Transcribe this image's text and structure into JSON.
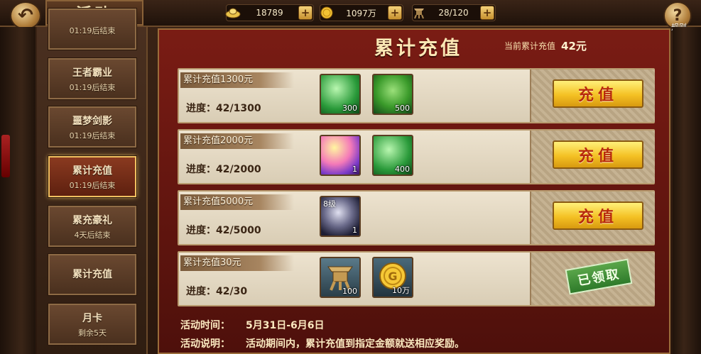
{
  "header": {
    "title": "活动",
    "back_icon": "back-arrow-icon",
    "help_label": "规则",
    "resources": [
      {
        "icon": "ingot-icon",
        "value": "18789"
      },
      {
        "icon": "gold-coin-icon",
        "value": "1097万"
      },
      {
        "icon": "vessel-icon",
        "value": "28/120"
      }
    ]
  },
  "sidebar": {
    "tabs": [
      {
        "name": "",
        "time": "01:19后结束"
      },
      {
        "name": "王者霸业",
        "time": "01:19后结束"
      },
      {
        "name": "噩梦剑影",
        "time": "01:19后结束"
      },
      {
        "name": "累计充值",
        "time": "01:19后结束",
        "active": true
      },
      {
        "name": "累充豪礼",
        "time": "4天后结束"
      },
      {
        "name": "累计充值",
        "time": ""
      },
      {
        "name": "月卡",
        "time": "剩余5天"
      }
    ]
  },
  "main": {
    "title": "累计充值",
    "current_label": "当前累计充值",
    "current_amount": "42元",
    "rows": [
      {
        "tag": "累计充值1300元",
        "progress": "进度：42/1300",
        "items": [
          {
            "icon": "green-gem-icon",
            "count": "300",
            "level": ""
          },
          {
            "icon": "green-pouch-icon",
            "count": "500",
            "level": ""
          }
        ],
        "action": "充值",
        "claimed": false
      },
      {
        "tag": "累计充值2000元",
        "progress": "进度：42/2000",
        "items": [
          {
            "icon": "rainbow-egg-icon",
            "count": "1",
            "level": ""
          },
          {
            "icon": "green-gem-icon",
            "count": "400",
            "level": ""
          }
        ],
        "action": "充值",
        "claimed": false
      },
      {
        "tag": "累计充值5000元",
        "progress": "进度：42/5000",
        "items": [
          {
            "icon": "dark-crystal-icon",
            "count": "1",
            "level": "8级"
          }
        ],
        "action": "充值",
        "claimed": false
      },
      {
        "tag": "累计充值30元",
        "progress": "进度：42/30",
        "items": [
          {
            "icon": "bronze-vessel-icon",
            "count": "100",
            "level": ""
          },
          {
            "icon": "gold-coin-icon",
            "count": "10万",
            "level": ""
          }
        ],
        "action": "已领取",
        "claimed": true
      }
    ],
    "activity_time_label": "活动时间：",
    "activity_time": "5月31日-6月6日",
    "activity_desc_label": "活动说明：",
    "activity_desc": "活动期间内，累计充值到指定金额就送相应奖励。"
  }
}
